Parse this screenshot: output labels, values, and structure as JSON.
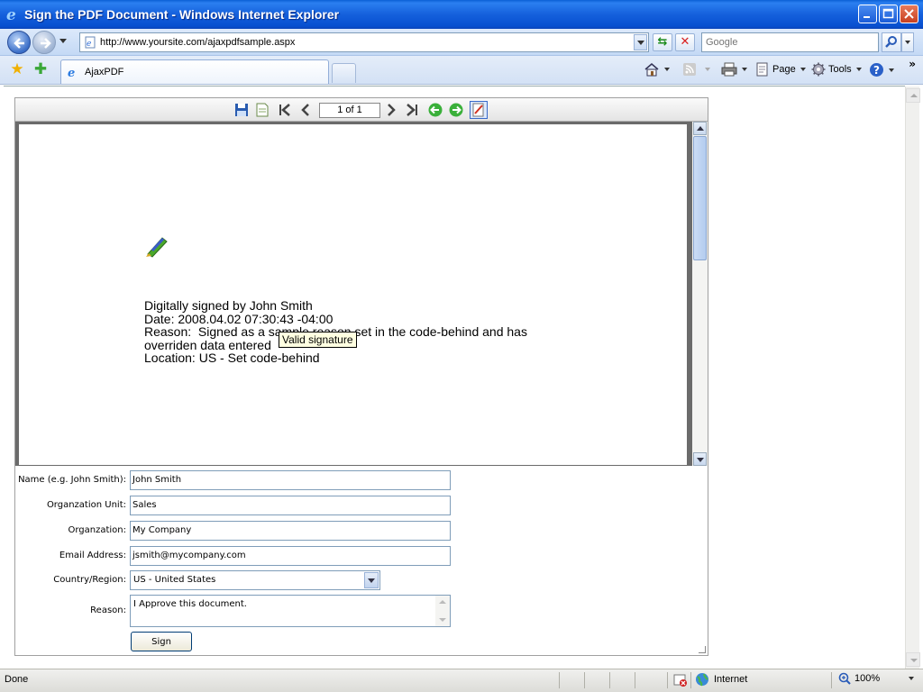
{
  "window": {
    "title": "Sign the PDF Document - Windows Internet Explorer"
  },
  "address_bar": {
    "url": "http://www.yoursite.com/ajaxpdfsample.aspx",
    "search_placeholder": "Google"
  },
  "tabs": [
    {
      "label": "AjaxPDF"
    }
  ],
  "command_bar": {
    "page_label": "Page",
    "tools_label": "Tools"
  },
  "viewer": {
    "page_indicator": "1 of 1",
    "signature_lines": [
      "Digitally signed by John Smith",
      "Date: 2008.04.02 07:30:43 -04:00",
      "Reason:  Signed as a sample reason set in the code-behind and has",
      "overriden data entered",
      "Location: US - Set code-behind"
    ],
    "tooltip": "Valid signature"
  },
  "form": {
    "fields": [
      {
        "label": "Name (e.g. John Smith):",
        "value": "John Smith"
      },
      {
        "label": "Organzation Unit:",
        "value": "Sales"
      },
      {
        "label": "Organzation:",
        "value": "My Company"
      },
      {
        "label": "Email Address:",
        "value": "jsmith@mycompany.com"
      }
    ],
    "country_label": "Country/Region:",
    "country_value": "US - United States",
    "reason_label": "Reason:",
    "reason_value": "I Approve this document.",
    "sign_button": "Sign"
  },
  "status_bar": {
    "status": "Done",
    "zone": "Internet",
    "zoom": "100%"
  },
  "colors": {
    "titlebar": "#1560dc",
    "tooltip_bg": "#ffffe1",
    "pdf_frame": "#6b6b6b"
  }
}
